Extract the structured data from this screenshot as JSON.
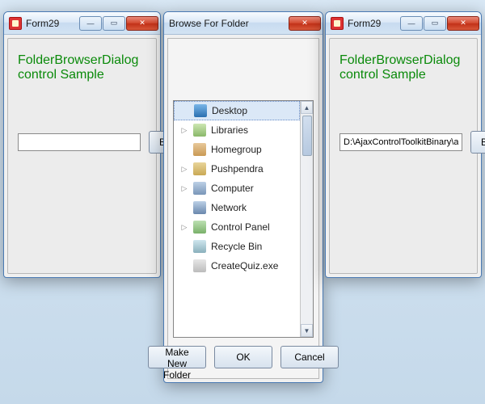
{
  "formLeft": {
    "title": "Form29",
    "heading": "FolderBrowserDialog  control Sample",
    "path_value": "",
    "browse_label": "Browse"
  },
  "browseDialog": {
    "title": "Browse For Folder",
    "nodes": [
      {
        "label": "Desktop",
        "icon": "desktop",
        "expander": "",
        "selected": true
      },
      {
        "label": "Libraries",
        "icon": "libraries",
        "expander": "▷",
        "selected": false
      },
      {
        "label": "Homegroup",
        "icon": "homegroup",
        "expander": "",
        "selected": false
      },
      {
        "label": "Pushpendra",
        "icon": "user",
        "expander": "▷",
        "selected": false
      },
      {
        "label": "Computer",
        "icon": "computer",
        "expander": "▷",
        "selected": false
      },
      {
        "label": "Network",
        "icon": "network",
        "expander": "",
        "selected": false
      },
      {
        "label": "Control Panel",
        "icon": "cpanel",
        "expander": "▷",
        "selected": false
      },
      {
        "label": "Recycle Bin",
        "icon": "recycle",
        "expander": "",
        "selected": false
      },
      {
        "label": "CreateQuiz.exe",
        "icon": "exe",
        "expander": "",
        "selected": false
      }
    ],
    "make_new_folder_label": "Make New Folder",
    "ok_label": "OK",
    "cancel_label": "Cancel"
  },
  "formRight": {
    "title": "Form29",
    "heading": "FolderBrowserDialog  control Sample",
    "path_value": "D:\\AjaxControlToolkitBinary\\ar",
    "browse_label": "Browse"
  }
}
